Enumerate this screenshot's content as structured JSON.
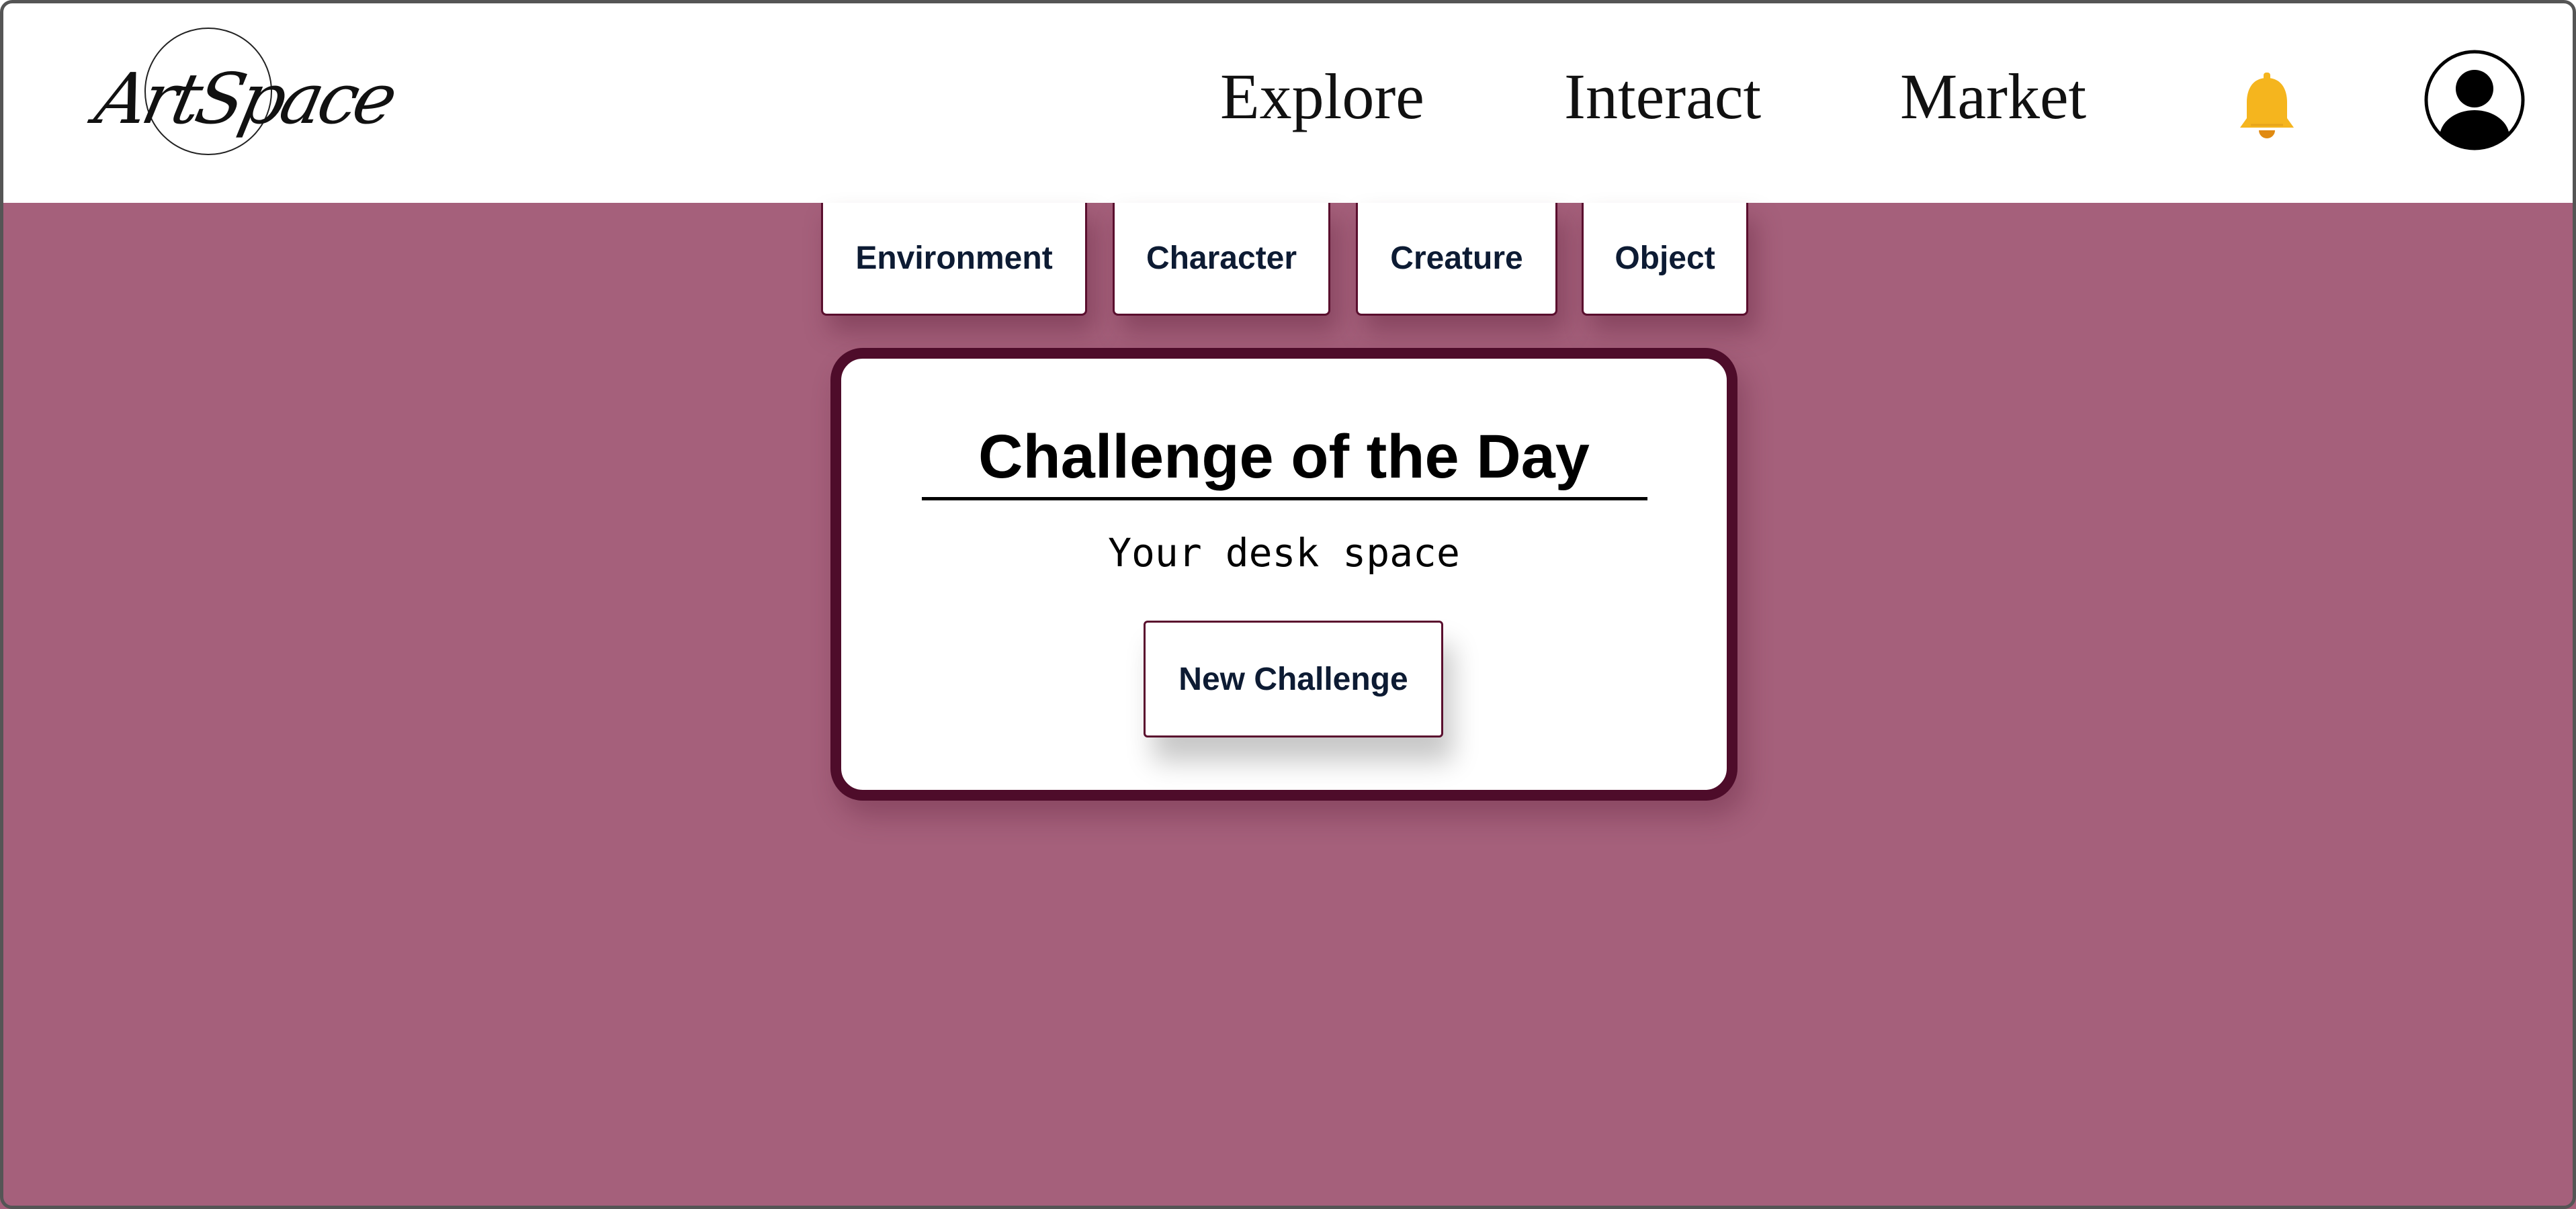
{
  "app": {
    "logo_text": "ArtSpace"
  },
  "nav": {
    "items": [
      {
        "label": "Explore"
      },
      {
        "label": "Interact"
      },
      {
        "label": "Market"
      }
    ]
  },
  "header_icons": {
    "notifications": "bell-icon",
    "profile": "user-avatar-icon"
  },
  "category_tabs": [
    {
      "label": "Environment"
    },
    {
      "label": "Character"
    },
    {
      "label": "Creature"
    },
    {
      "label": "Object"
    }
  ],
  "challenge_card": {
    "title": "Challenge of the Day",
    "prompt": "Your desk space",
    "button_label": "New Challenge"
  },
  "colors": {
    "background": "#a5607b",
    "header": "#ffffff",
    "accent_border": "#4e0c2a",
    "bell": "#f5b51e",
    "button_text": "#0d1b33"
  }
}
